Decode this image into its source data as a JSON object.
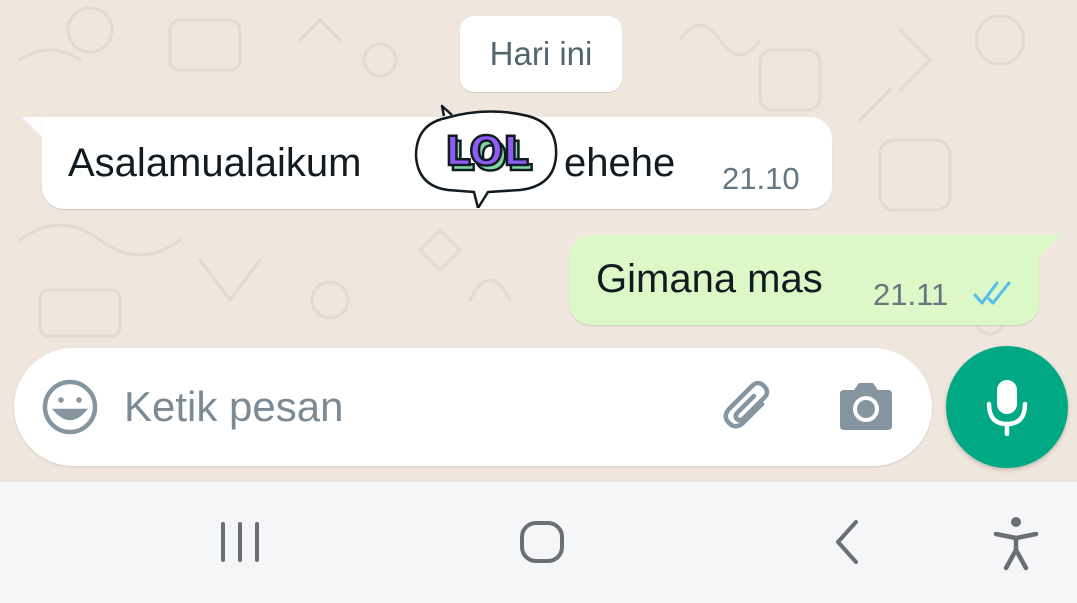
{
  "chat": {
    "date_divider": "Hari ini",
    "incoming": {
      "text_before": "Asalamualaikum",
      "sticker_text": "LOL",
      "text_after": "ehehe",
      "time": "21.10"
    },
    "outgoing": {
      "text": "Gimana mas",
      "time": "21.11",
      "status": "read"
    }
  },
  "composer": {
    "placeholder": "Ketik pesan",
    "value": ""
  },
  "icons": {
    "emoji": "smiley-icon",
    "attach": "paperclip-icon",
    "camera": "camera-icon",
    "mic": "microphone-icon",
    "nav_recents": "recent-apps-icon",
    "nav_home": "home-icon",
    "nav_back": "back-icon",
    "nav_accessibility": "accessibility-icon"
  },
  "colors": {
    "wallpaper": "#efe7dd",
    "outgoing_bubble": "#dcf8c6",
    "incoming_bubble": "#ffffff",
    "accent": "#00a884",
    "read_ticks": "#53bdeb",
    "sticker_purple": "#8e5cf7",
    "sticker_green": "#7fd8a2"
  }
}
